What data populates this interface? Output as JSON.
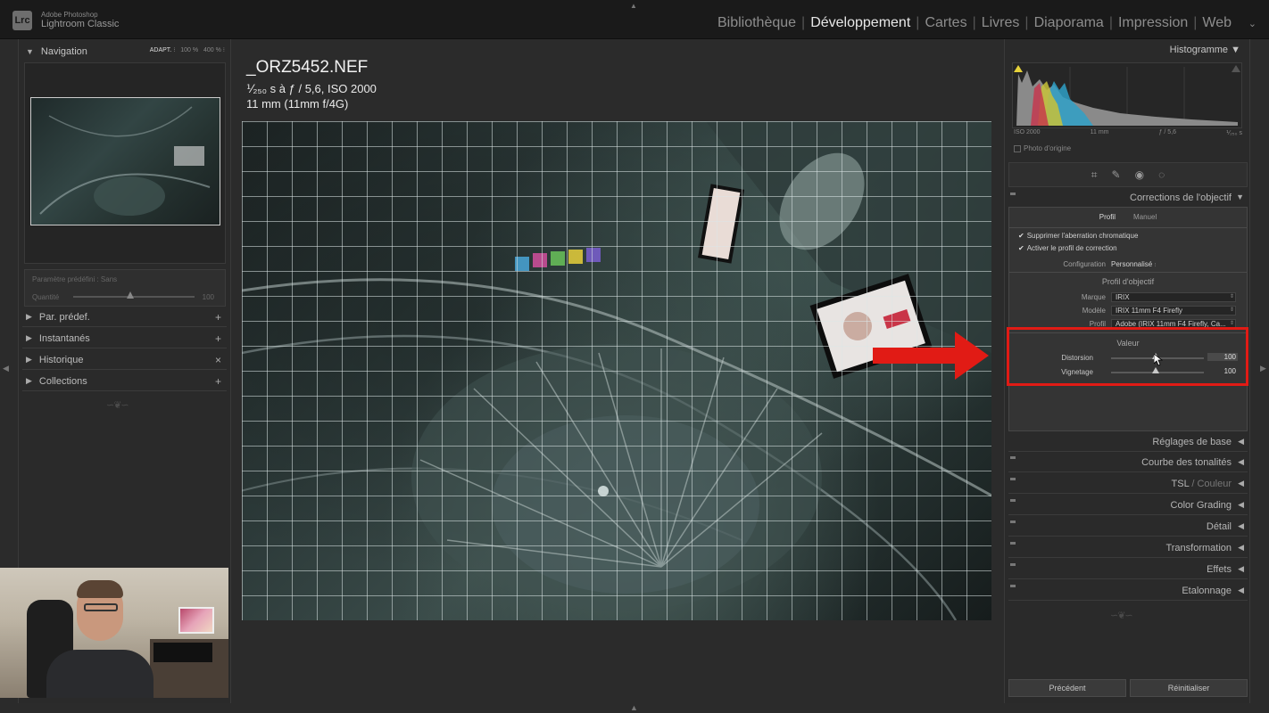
{
  "app": {
    "logo_text": "Lrc",
    "brand_line1": "Adobe Photoshop",
    "brand_line2": "Lightroom Classic"
  },
  "modules": [
    {
      "label": "Bibliothèque",
      "active": false
    },
    {
      "label": "Développement",
      "active": true
    },
    {
      "label": "Cartes",
      "active": false
    },
    {
      "label": "Livres",
      "active": false
    },
    {
      "label": "Diaporama",
      "active": false
    },
    {
      "label": "Impression",
      "active": false
    },
    {
      "label": "Web",
      "active": false
    }
  ],
  "left_panel": {
    "navigation": {
      "title": "Navigation",
      "zoom_fit": "ADAPT.",
      "zoom_100": "100 %",
      "zoom_400": "400 %"
    },
    "preset": {
      "label": "Paramètre prédéfini : Sans",
      "amount_label": "Quantité",
      "amount_value": "100"
    },
    "sections": [
      {
        "label": "Par. prédef.",
        "action": "+"
      },
      {
        "label": "Instantanés",
        "action": "+"
      },
      {
        "label": "Historique",
        "action": "×"
      },
      {
        "label": "Collections",
        "action": "+"
      }
    ]
  },
  "photo": {
    "filename": "_ORZ5452.NEF",
    "exposure_line": "⅟₂₅₀ s à ƒ / 5,6, ISO 2000",
    "lens_line": "11 mm (11mm f/4G)"
  },
  "right_panel": {
    "histogram": {
      "title": "Histogramme",
      "iso": "ISO 2000",
      "focal": "11 mm",
      "aperture": "ƒ / 5,6",
      "shutter": "⅟₂₅₀ s",
      "original_photo_label": "Photo d'origine"
    },
    "lens_corrections": {
      "title": "Corrections de l'objectif",
      "tabs": [
        {
          "label": "Profil",
          "active": true
        },
        {
          "label": "Manuel",
          "active": false
        }
      ],
      "remove_ca_label": "Supprimer l'aberration chromatique",
      "enable_profile_label": "Activer le profil de correction",
      "configuration_label": "Configuration",
      "configuration_value": "Personnalisé",
      "lens_profile_title": "Profil d'objectif",
      "make_label": "Marque",
      "make_value": "IRIX",
      "model_label": "Modèle",
      "model_value": "IRIX 11mm F4 Firefly",
      "profile_label": "Profil",
      "profile_value": "Adobe (IRIX 11mm F4 Firefly, Ca...",
      "amount_title": "Valeur",
      "distortion_label": "Distorsion",
      "distortion_value": "100",
      "vignetting_label": "Vignetage",
      "vignetting_value": "100"
    },
    "sections": [
      {
        "label": "Réglages de base",
        "dim_suffix": ""
      },
      {
        "label": "Courbe des tonalités",
        "dim_suffix": ""
      },
      {
        "label": "TSL",
        "dim_suffix": " / Couleur"
      },
      {
        "label": "Color Grading",
        "dim_suffix": ""
      },
      {
        "label": "Détail",
        "dim_suffix": ""
      },
      {
        "label": "Transformation",
        "dim_suffix": ""
      },
      {
        "label": "Effets",
        "dim_suffix": ""
      },
      {
        "label": "Etalonnage",
        "dim_suffix": ""
      }
    ],
    "buttons": {
      "previous": "Précédent",
      "reset": "Réinitialiser"
    }
  },
  "colors": {
    "annotation_red": "#e11b15",
    "active_module": "#e8e8e8",
    "panel_bg": "#2a2a2a"
  }
}
